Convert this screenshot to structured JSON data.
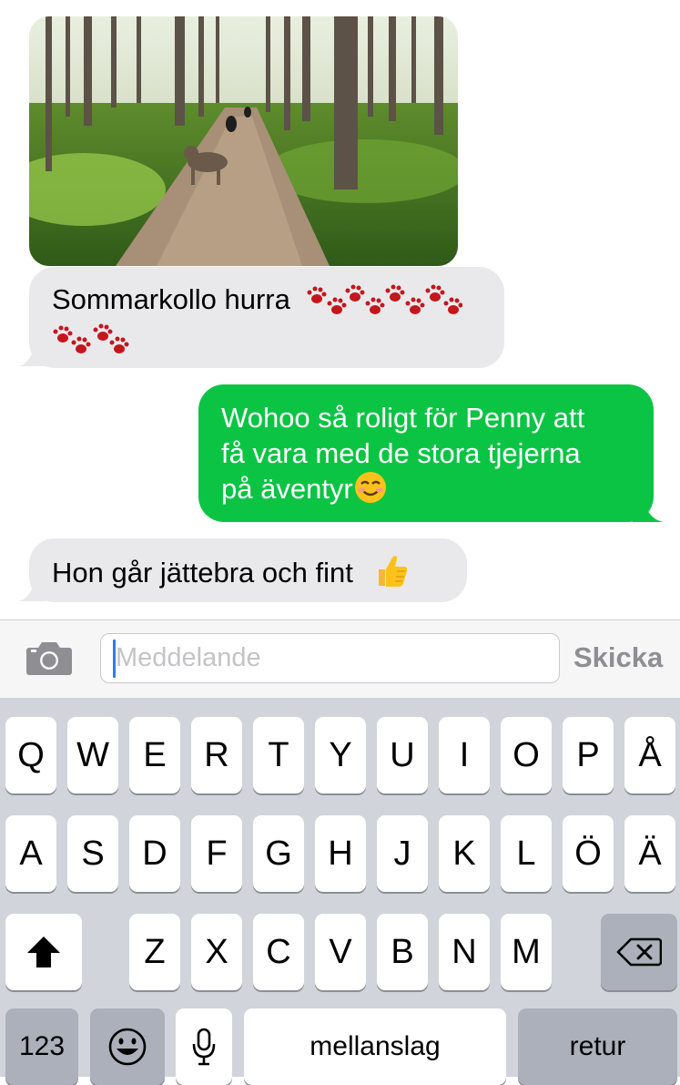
{
  "thread": {
    "messages": [
      {
        "from": "incoming",
        "type": "photo",
        "image": "dog-on-forest-path-photo"
      },
      {
        "from": "incoming",
        "text": "Sommarkollo hurra",
        "emoji": "paw-prints"
      },
      {
        "from": "outgoing",
        "lines": [
          "Wohoo så roligt för Penny att",
          "få vara med de stora tjejerna",
          "på äventyr"
        ],
        "emoji": "smiling-face"
      },
      {
        "from": "incoming",
        "text": "Hon går jättebra och fint",
        "emoji": "thumbs-up"
      }
    ]
  },
  "composer": {
    "camera_icon": "camera-icon",
    "placeholder": "Meddelande",
    "send_label": "Skicka"
  },
  "keyboard": {
    "row1": [
      "Q",
      "W",
      "E",
      "R",
      "T",
      "Y",
      "U",
      "I",
      "O",
      "P",
      "Å"
    ],
    "row2": [
      "A",
      "S",
      "D",
      "F",
      "G",
      "H",
      "J",
      "K",
      "L",
      "Ö",
      "Ä"
    ],
    "row3": [
      "Z",
      "X",
      "C",
      "V",
      "B",
      "N",
      "M"
    ],
    "numbers_label": "123",
    "space_label": "mellanslag",
    "return_label": "retur",
    "shift_icon": "shift-icon",
    "backspace_icon": "backspace-icon",
    "emoji_icon": "emoji-icon",
    "mic_icon": "microphone-icon"
  },
  "colors": {
    "incoming_bubble": "#e9e9ec",
    "outgoing_bubble": "#0cc444",
    "keyboard_bg": "#d1d4da"
  }
}
